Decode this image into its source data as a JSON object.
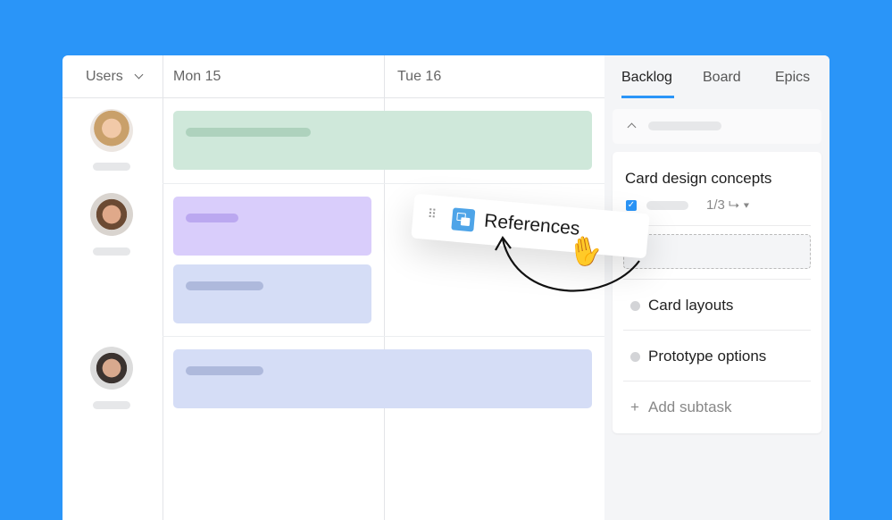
{
  "header": {
    "users_label": "Users",
    "days": [
      "Mon 15",
      "Tue 16"
    ]
  },
  "tabs": [
    {
      "label": "Backlog",
      "active": true
    },
    {
      "label": "Board"
    },
    {
      "label": "Epics"
    }
  ],
  "card": {
    "title": "Card design concepts",
    "progress": "1/3",
    "subtasks": [
      "Card layouts",
      "Prototype options"
    ],
    "add_label": "Add subtask"
  },
  "dragged": {
    "label": "References"
  },
  "colors": {
    "background": "#2a95f8",
    "accent": "#2a95f8",
    "green": "#cfe8da",
    "purple": "#d9cdfb",
    "blue": "#d5ddf6"
  }
}
